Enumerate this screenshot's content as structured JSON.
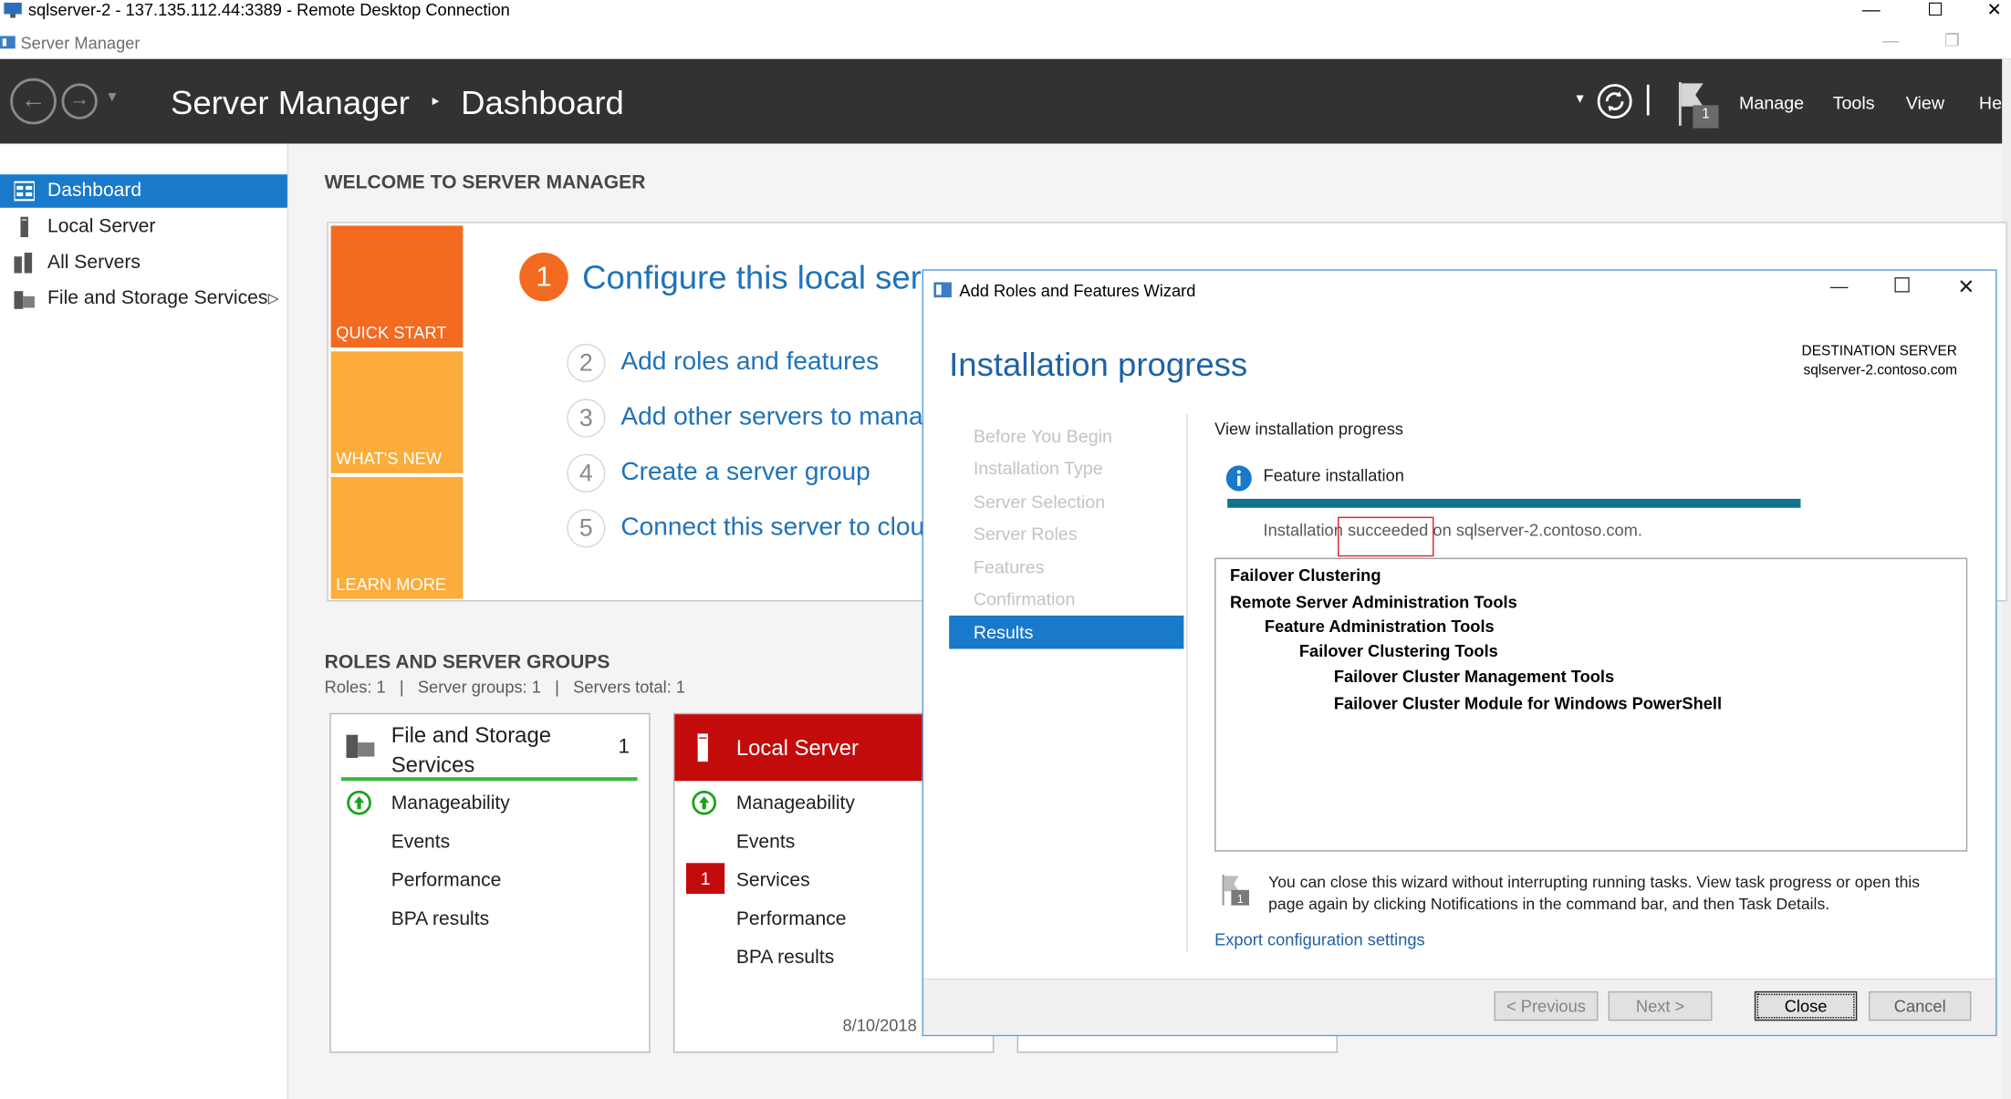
{
  "rdp": {
    "title": "sqlserver-2 - 137.135.112.44:3389 - Remote Desktop Connection",
    "minimize": "—",
    "maximize": "☐",
    "close": "✕"
  },
  "window": {
    "title": "Server Manager",
    "minimize": "—",
    "restore": "❐"
  },
  "header": {
    "app": "Server Manager",
    "separator": "‣",
    "page": "Dashboard",
    "notification_count": "1",
    "menu": [
      "Manage",
      "Tools",
      "View",
      "Help"
    ]
  },
  "sidebar": {
    "items": [
      {
        "label": "Dashboard",
        "icon": "dashboard-icon"
      },
      {
        "label": "Local Server",
        "icon": "server-icon"
      },
      {
        "label": "All Servers",
        "icon": "servers-icon"
      },
      {
        "label": "File and Storage Services",
        "icon": "storage-icon"
      }
    ],
    "expand_glyph": "▷"
  },
  "welcome": {
    "heading": "WELCOME TO SERVER MANAGER",
    "tiles": [
      "QUICK START",
      "WHAT'S NEW",
      "LEARN MORE"
    ],
    "primary_step": {
      "num": "1",
      "label": "Configure this local server"
    },
    "steps": [
      {
        "num": "2",
        "label": "Add roles and features"
      },
      {
        "num": "3",
        "label": "Add other servers to manage"
      },
      {
        "num": "4",
        "label": "Create a server group"
      },
      {
        "num": "5",
        "label": "Connect this server to cloud services"
      }
    ]
  },
  "roles": {
    "heading": "ROLES AND SERVER GROUPS",
    "summary": "Roles: 1   |   Server groups: 1   |   Servers total: 1",
    "cards": [
      {
        "title": "File and Storage Services",
        "count": "1",
        "rows": [
          "Manageability",
          "Events",
          "Performance",
          "BPA results"
        ]
      },
      {
        "title": "Local Server",
        "count": "1",
        "rows": [
          "Manageability",
          "Events",
          "Services",
          "Performance",
          "BPA results"
        ],
        "services_alert": "1",
        "date": "8/10/2018"
      }
    ]
  },
  "wizard": {
    "title": "Add Roles and Features Wizard",
    "heading": "Installation progress",
    "dest_label": "DESTINATION SERVER",
    "dest_server": "sqlserver-2.contoso.com",
    "steps": [
      "Before You Begin",
      "Installation Type",
      "Server Selection",
      "Server Roles",
      "Features",
      "Confirmation",
      "Results"
    ],
    "current_step": "Results",
    "view_label": "View installation progress",
    "feature_installation": "Feature installation",
    "progress": 1.0,
    "status": "Installation succeeded on sqlserver-2.contoso.com.",
    "features": [
      {
        "label": "Failover Clustering",
        "level": 0
      },
      {
        "label": "Remote Server Administration Tools",
        "level": 0
      },
      {
        "label": "Feature Administration Tools",
        "level": 1
      },
      {
        "label": "Failover Clustering Tools",
        "level": 2
      },
      {
        "label": "Failover Cluster Management Tools",
        "level": 3
      },
      {
        "label": "Failover Cluster Module for Windows PowerShell",
        "level": 3
      }
    ],
    "note": "You can close this wizard without interrupting running tasks. View task progress or open this page again by clicking Notifications in the command bar, and then Task Details.",
    "note_badge": "1",
    "export_link": "Export configuration settings",
    "buttons": {
      "previous": "< Previous",
      "next": "Next >",
      "close": "Close",
      "cancel": "Cancel"
    },
    "colors": {
      "accent": "#1979ca",
      "progress": "#0e7490",
      "highlight_box": "#e0202a"
    }
  }
}
